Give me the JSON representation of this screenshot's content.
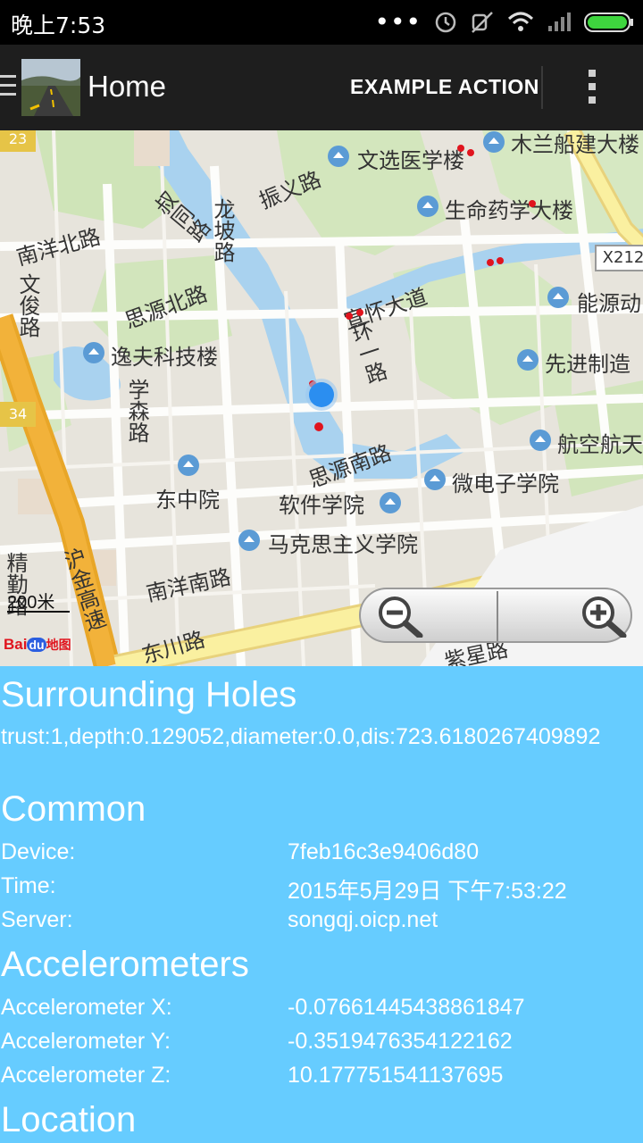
{
  "status": {
    "time": "晚上7:53",
    "dots": "•••"
  },
  "actionbar": {
    "title": "Home",
    "action_label": "EXAMPLE ACTION"
  },
  "map": {
    "scale": "200米",
    "attribution_bai": "Bai",
    "attribution_du": "du",
    "attribution_map": "地图",
    "labels": {
      "wenxuan": "文选医学楼",
      "mulan": "木兰船建大楼",
      "shengming": "生命药学大楼",
      "x212": "X212",
      "nengyuan": "能源动",
      "xianjin": "先进制造",
      "hangkong": "航空航天",
      "zhenyi": "振义路",
      "shutong": "叔同路",
      "longpo": "龙坡路",
      "nanyangbei": "南洋北路",
      "wenjun": "文俊路",
      "siyuanbei": "思源北路",
      "yifu": "逸夫科技楼",
      "xuesen": "学森路",
      "xuanhuai": "宣怀大道",
      "huanyi": "环一路",
      "siyuannan": "思源南路",
      "weidianzi": "微电子学院",
      "dongzhong": "东中院",
      "ruanjian": "软件学院",
      "makesi": "马克思主义学院",
      "nanyangnan": "南洋南路",
      "hujin": "沪金高速",
      "dongchuan": "东川路",
      "zixing": "紫星路",
      "jingqin": "精勤路",
      "edge23": "23",
      "edge34": "34"
    }
  },
  "surrounding": {
    "title": "Surrounding Holes",
    "text": "trust:1,depth:0.129052,diameter:0.0,dis:723.6180267409892"
  },
  "common": {
    "title": "Common",
    "rows": [
      {
        "label": "Device:",
        "value": "7feb16c3e9406d80"
      },
      {
        "label": "Time:",
        "value": "2015年5月29日 下午7:53:22"
      },
      {
        "label": "Server:",
        "value": "songqj.oicp.net"
      }
    ]
  },
  "accelerometers": {
    "title": "Accelerometers",
    "rows": [
      {
        "label": "Accelerometer X:",
        "value": "-0.07661445438861847"
      },
      {
        "label": "Accelerometer Y:",
        "value": "-0.3519476354122162"
      },
      {
        "label": "Accelerometer Z:",
        "value": "10.177751541137695"
      }
    ]
  },
  "location": {
    "title": "Location"
  },
  "colors": {
    "accent": "#66ccff",
    "actionbar": "#1e1e1e",
    "location_dot": "#2b8ef0",
    "poi_marker": "#e0141e",
    "highway": "#f2b23a"
  },
  "icons": [
    "drawer-icon",
    "app-logo-icon",
    "overflow-menu-icon",
    "zoom-out-icon",
    "zoom-in-icon",
    "location-dot-icon",
    "school-icon",
    "wifi-icon",
    "battery-icon",
    "signal-icon",
    "mute-icon",
    "alarm-icon"
  ]
}
